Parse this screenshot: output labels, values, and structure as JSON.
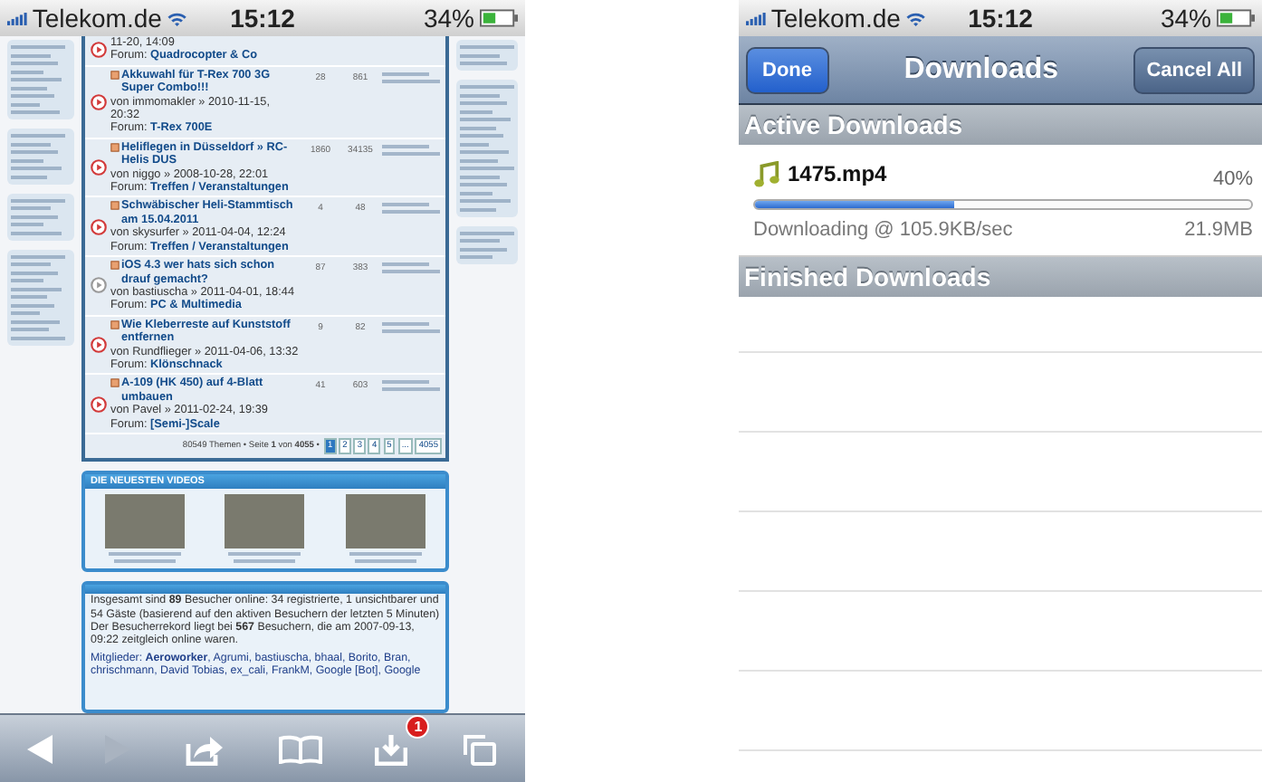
{
  "left_phone": {
    "status_bar": {
      "carrier": "Telekom.de",
      "time": "15:12",
      "battery": "34%"
    },
    "threads": [
      {
        "author": "11-20, 14:09",
        "forum_label": "Forum:",
        "forum": "Quadrocopter & Co",
        "unread": true
      },
      {
        "title": "Akkuwahl für T-Rex 700 3G Super Combo!!!",
        "author": "von immomakler » 2010-11-15, 20:32",
        "forum_label": "Forum:",
        "forum": "T-Rex 700E",
        "unread": true,
        "replies": "28",
        "views": "861"
      },
      {
        "title": "Heliflegen in Düsseldorf » RC-Helis DUS",
        "author": "von niggo » 2008-10-28, 22:01",
        "forum_label": "Forum:",
        "forum": "Treffen / Veranstaltungen",
        "unread": true,
        "replies": "1860",
        "views": "34135"
      },
      {
        "title": "Schwäbischer Heli-Stammtisch am 15.04.2011",
        "author": "von skysurfer » 2011-04-04, 12:24",
        "forum_label": "Forum:",
        "forum": "Treffen / Veranstaltungen",
        "unread": true,
        "replies": "4",
        "views": "48"
      },
      {
        "title": "iOS 4.3 wer hats sich schon drauf gemacht?",
        "author": "von bastiuscha » 2011-04-01, 18:44",
        "forum_label": "Forum:",
        "forum": "PC & Multimedia",
        "unread": false,
        "replies": "87",
        "views": "383"
      },
      {
        "title": "Wie Kleberreste auf Kunststoff entfernen",
        "author": "von Rundflieger » 2011-04-06, 13:32",
        "forum_label": "Forum:",
        "forum": "Klönschnack",
        "unread": true,
        "replies": "9",
        "views": "82"
      },
      {
        "title": "A-109 (HK 450) auf 4-Blatt umbauen",
        "author": "von Pavel » 2011-02-24, 19:39",
        "forum_label": "Forum:",
        "forum": "[Semi-]Scale",
        "unread": true,
        "replies": "41",
        "views": "603"
      }
    ],
    "pagination": {
      "summary": "80549 Themen • Seite **1** von **4055** •",
      "pages": [
        {
          "label": "1",
          "selected": true
        },
        {
          "label": "2",
          "selected": false
        },
        {
          "label": "3",
          "selected": false
        },
        {
          "label": "4",
          "selected": false
        },
        {
          "label": "5",
          "selected": false
        },
        {
          "label": "...",
          "selected": false
        },
        {
          "label": "4055",
          "selected": false
        }
      ]
    },
    "videos": {
      "title": "DIE NEUESTEN VIDEOS"
    },
    "online": {
      "paragraphs": [
        "Insgesamt sind **89** Besucher online: 34 registrierte, 1 unsichtbarer und 54 Gäste (basierend auf den aktiven Besuchern der letzten 5 Minuten)",
        "Der Besucherrekord liegt bei **567** Besuchern, die am 2007-09-13, 09:22 zeitgleich online waren.",
        "Mitglieder: **Aeroworker**, Agrumi, bastiuscha, bhaal, Borito, Bran, chrischmann, David Tobias, ex_cali, FrankM, Google [Bot], Google"
      ]
    },
    "toolbar": {
      "forward_disabled": true,
      "downloads_badge": "1"
    }
  },
  "right_phone": {
    "status_bar": {
      "carrier": "Telekom.de",
      "time": "15:12",
      "battery": "34%"
    },
    "nav": {
      "left_button": "Done",
      "title": "Downloads",
      "right_button": "Cancel All"
    },
    "sections": [
      {
        "title": "Active Downloads",
        "items": [
          {
            "name": "1475.mp4",
            "percent": "40%",
            "level": 0.4,
            "status": "Downloading @ 105.9KB/sec",
            "size": "21.9MB"
          }
        ]
      },
      {
        "title": "Finished Downloads"
      }
    ]
  }
}
